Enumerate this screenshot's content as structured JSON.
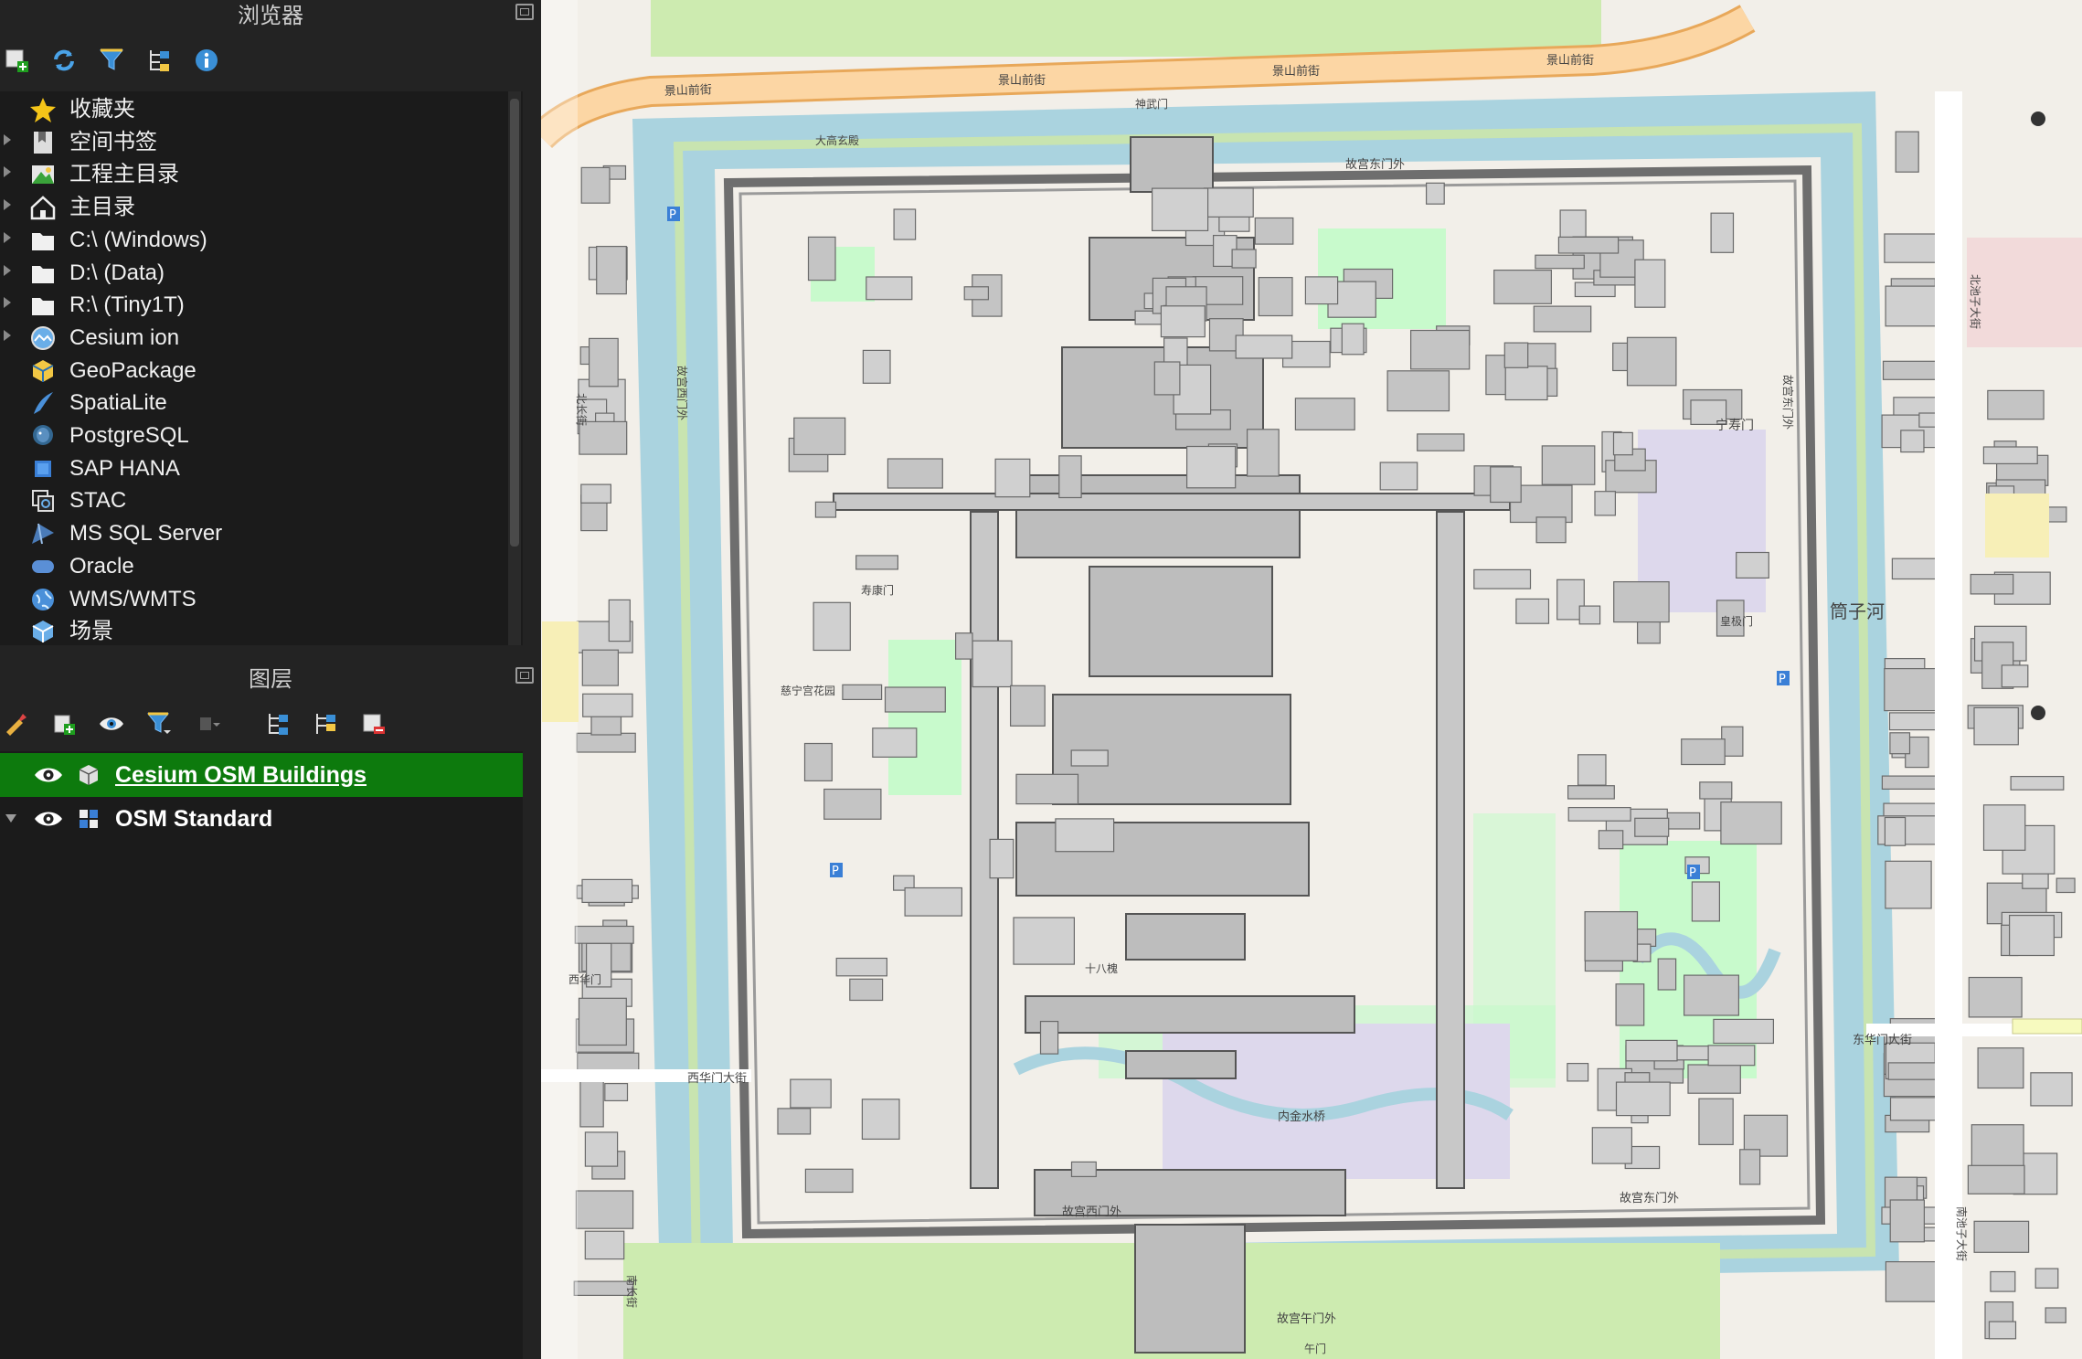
{
  "browser_panel": {
    "title": "浏览器",
    "toolbar": [
      {
        "icon": "add-layer-icon"
      },
      {
        "icon": "refresh-icon"
      },
      {
        "icon": "filter-icon"
      },
      {
        "icon": "collapse-all-icon"
      },
      {
        "icon": "info-icon"
      }
    ],
    "items": [
      {
        "label": "收藏夹",
        "icon": "star-icon",
        "expandable": false
      },
      {
        "label": "空间书签",
        "icon": "bookmark-icon",
        "expandable": true
      },
      {
        "label": "工程主目录",
        "icon": "project-home-icon",
        "expandable": true
      },
      {
        "label": "主目录",
        "icon": "home-icon",
        "expandable": true
      },
      {
        "label": "C:\\ (Windows)",
        "icon": "folder-icon",
        "expandable": true
      },
      {
        "label": "D:\\ (Data)",
        "icon": "folder-icon",
        "expandable": true
      },
      {
        "label": "R:\\ (Tiny1T)",
        "icon": "folder-icon",
        "expandable": true
      },
      {
        "label": "Cesium ion",
        "icon": "cesium-icon",
        "expandable": true
      },
      {
        "label": "GeoPackage",
        "icon": "geopackage-icon",
        "expandable": false
      },
      {
        "label": "SpatiaLite",
        "icon": "spatialite-icon",
        "expandable": false
      },
      {
        "label": "PostgreSQL",
        "icon": "postgresql-icon",
        "expandable": false
      },
      {
        "label": "SAP HANA",
        "icon": "sap-hana-icon",
        "expandable": false
      },
      {
        "label": "STAC",
        "icon": "stac-icon",
        "expandable": false
      },
      {
        "label": "MS SQL Server",
        "icon": "mssql-icon",
        "expandable": false
      },
      {
        "label": "Oracle",
        "icon": "oracle-icon",
        "expandable": false
      },
      {
        "label": "WMS/WMTS",
        "icon": "wms-icon",
        "expandable": false
      },
      {
        "label": "场景",
        "icon": "scene-icon",
        "expandable": false
      }
    ]
  },
  "layers_panel": {
    "title": "图层",
    "toolbar": [
      {
        "icon": "style-icon"
      },
      {
        "icon": "add-group-icon"
      },
      {
        "icon": "visibility-icon"
      },
      {
        "icon": "filter-legend-icon"
      },
      {
        "icon": "filter-expression-icon"
      },
      {
        "icon": "expand-all-icon"
      },
      {
        "icon": "collapse-all-icon"
      },
      {
        "icon": "remove-layer-icon"
      }
    ],
    "layers": [
      {
        "name": "Cesium OSM Buildings",
        "visible": true,
        "selected": true,
        "icon": "tiled-scene-icon"
      },
      {
        "name": "OSM Standard",
        "visible": true,
        "selected": false,
        "icon": "raster-tile-icon"
      }
    ]
  },
  "map": {
    "colors": {
      "background": "#f2efe9",
      "water": "#aad3df",
      "road_primary": "#fcd6a4",
      "park": "#c8facc",
      "building": "#d9d0c9",
      "building_3d": "#bdbdbd"
    },
    "labels": {
      "jingshan_street": "景山前街",
      "north_moat": "故宫东门外",
      "palace_west": "故宫西门外",
      "palace_east": "故宫东门外",
      "palace_south_w": "故宫西门外",
      "palace_south_e": "故宫东门外",
      "south_gate": "故宫午门外",
      "shenwu_gate": "神武门",
      "donghuamen_street": "东华门大街",
      "xihuamen_street": "西华门大街",
      "tongzi_river": "筒子河",
      "nanchang_street": "南长街",
      "beichang_street": "北长街",
      "nanchizi_street": "南池子大街",
      "beichizi_street": "北池子大街",
      "xiyuan": "西华门",
      "neijin_bridge": "内金水桥",
      "ningshou_palace": "宁寿门",
      "huangji_gate": "皇极门",
      "cining": "慈宁宫花园",
      "shoukang": "寿康门",
      "taihe_area": "十八槐",
      "dagaoxuandian": "大高玄殿",
      "wumen_south": "午门"
    }
  }
}
